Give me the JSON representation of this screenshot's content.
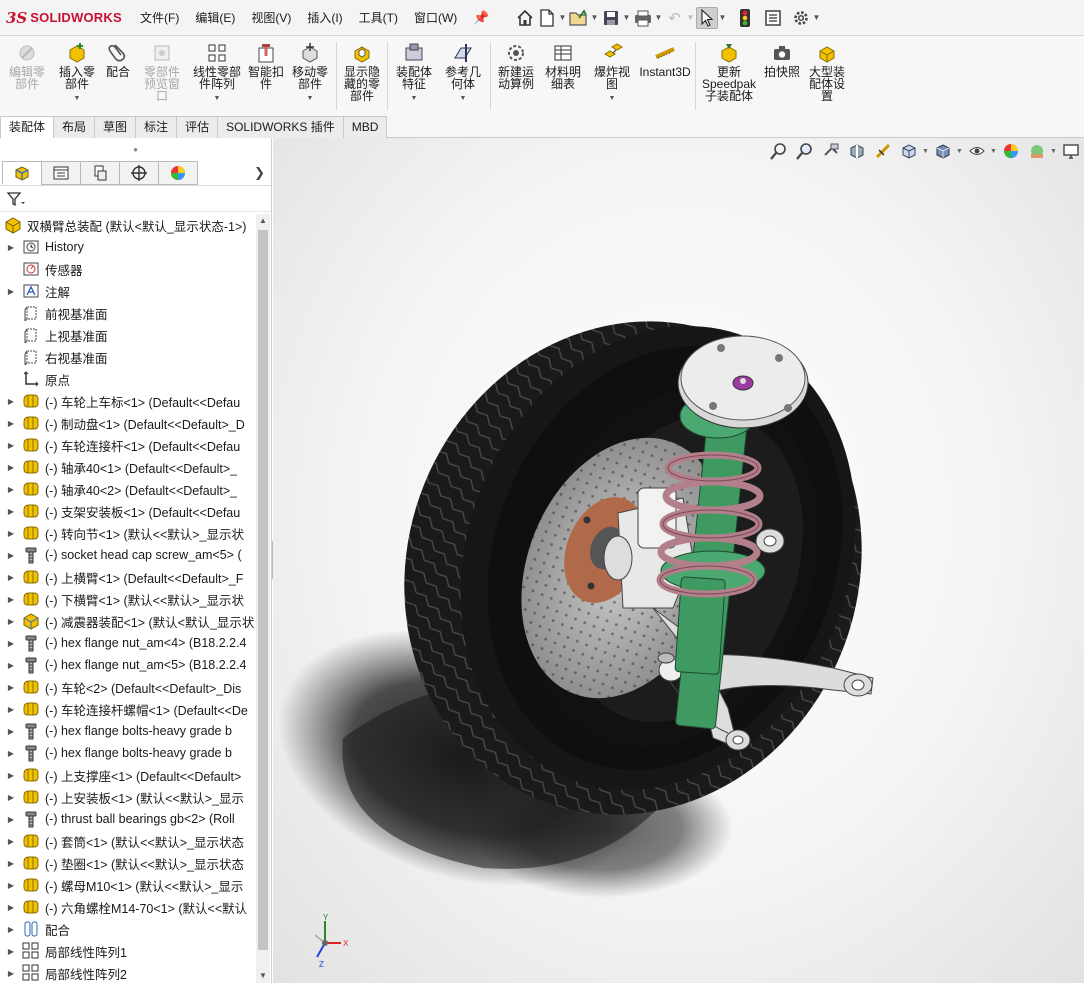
{
  "app": {
    "brand_ds": "3S",
    "brand_name": "SOLIDWORKS"
  },
  "menu": [
    "文件(F)",
    "编辑(E)",
    "视图(V)",
    "插入(I)",
    "工具(T)",
    "窗口(W)"
  ],
  "commands": [
    {
      "label": "编辑零\n部件",
      "disabled": true,
      "icon": "edit-component-icon"
    },
    {
      "label": "插入零\n部件",
      "disabled": false,
      "icon": "insert-component-icon",
      "dropdown": true
    },
    {
      "label": "配合",
      "disabled": false,
      "icon": "mate-icon"
    },
    {
      "label": "零部件\n预览窗\n口",
      "disabled": true,
      "icon": "component-preview-icon"
    },
    {
      "label": "线性零部\n件阵列",
      "disabled": false,
      "icon": "linear-pattern-icon",
      "dropdown": true
    },
    {
      "label": "智能扣\n件",
      "disabled": false,
      "icon": "smart-fastener-icon"
    },
    {
      "label": "移动零\n部件",
      "disabled": false,
      "icon": "move-component-icon",
      "dropdown": true
    },
    {
      "label": "显示隐\n藏的零\n部件",
      "disabled": false,
      "icon": "show-hidden-icon"
    },
    {
      "label": "装配体\n特征",
      "disabled": false,
      "icon": "assembly-feature-icon",
      "dropdown": true
    },
    {
      "label": "参考几\n何体",
      "disabled": false,
      "icon": "reference-geometry-icon",
      "dropdown": true
    },
    {
      "label": "新建运\n动算例",
      "disabled": false,
      "icon": "motion-study-icon"
    },
    {
      "label": "材料明\n细表",
      "disabled": false,
      "icon": "bom-icon"
    },
    {
      "label": "爆炸视\n图",
      "disabled": false,
      "icon": "exploded-view-icon",
      "dropdown": true
    },
    {
      "label": "Instant3D",
      "disabled": false,
      "icon": "instant3d-icon"
    },
    {
      "label": "更新\nSpeedpak\n子装配体",
      "disabled": false,
      "icon": "speedpak-icon"
    },
    {
      "label": "拍快照",
      "disabled": false,
      "icon": "snapshot-icon"
    },
    {
      "label": "大型装\n配体设\n置",
      "disabled": false,
      "icon": "large-assembly-icon"
    }
  ],
  "tabs": [
    {
      "label": "装配体",
      "active": true
    },
    {
      "label": "布局"
    },
    {
      "label": "草图"
    },
    {
      "label": "标注"
    },
    {
      "label": "评估"
    },
    {
      "label": "SOLIDWORKS 插件"
    },
    {
      "label": "MBD"
    }
  ],
  "tree": {
    "root": "双横臂总装配  (默认<默认_显示状态-1>)",
    "items": [
      {
        "label": "History",
        "icon": "history-icon",
        "expand": true
      },
      {
        "label": "传感器",
        "icon": "sensor-icon",
        "expand": false
      },
      {
        "label": "注解",
        "icon": "annotation-icon",
        "expand": true
      },
      {
        "label": "前视基准面",
        "icon": "plane-icon",
        "expand": false
      },
      {
        "label": "上视基准面",
        "icon": "plane-icon",
        "expand": false
      },
      {
        "label": "右视基准面",
        "icon": "plane-icon",
        "expand": false
      },
      {
        "label": "原点",
        "icon": "origin-icon",
        "expand": false
      },
      {
        "label": "(-) 车轮上车标<1> (Default<<Defau",
        "icon": "part-icon",
        "expand": true
      },
      {
        "label": "(-) 制动盘<1> (Default<<Default>_D",
        "icon": "part-icon",
        "expand": true
      },
      {
        "label": "(-) 车轮连接杆<1> (Default<<Defau",
        "icon": "part-icon",
        "expand": true
      },
      {
        "label": "(-) 轴承40<1> (Default<<Default>_",
        "icon": "part-icon",
        "expand": true
      },
      {
        "label": "(-) 轴承40<2> (Default<<Default>_",
        "icon": "part-icon",
        "expand": true
      },
      {
        "label": "(-) 支架安装板<1> (Default<<Defau",
        "icon": "part-icon",
        "expand": true
      },
      {
        "label": "(-) 转向节<1> (默认<<默认>_显示状",
        "icon": "part-icon",
        "expand": true
      },
      {
        "label": "(-) socket head cap screw_am<5> (",
        "icon": "toolbox-icon",
        "expand": true
      },
      {
        "label": "(-) 上横臂<1> (Default<<Default>_F",
        "icon": "part-icon",
        "expand": true
      },
      {
        "label": "(-) 下横臂<1> (默认<<默认>_显示状",
        "icon": "part-icon",
        "expand": true
      },
      {
        "label": "(-) 减震器装配<1> (默认<默认_显示状",
        "icon": "subassembly-icon",
        "expand": true
      },
      {
        "label": "(-) hex flange nut_am<4> (B18.2.2.4",
        "icon": "toolbox-icon",
        "expand": true
      },
      {
        "label": "(-) hex flange nut_am<5> (B18.2.2.4",
        "icon": "toolbox-icon",
        "expand": true
      },
      {
        "label": "(-) 车轮<2> (Default<<Default>_Dis",
        "icon": "part-icon",
        "expand": true
      },
      {
        "label": "(-) 车轮连接杆螺帽<1> (Default<<De",
        "icon": "part-icon",
        "expand": true
      },
      {
        "label": "(-) hex flange bolts-heavy grade b",
        "icon": "toolbox-icon",
        "expand": true
      },
      {
        "label": "(-) hex flange bolts-heavy grade b",
        "icon": "toolbox-icon",
        "expand": true
      },
      {
        "label": "(-) 上支撑座<1> (Default<<Default>",
        "icon": "part-icon",
        "expand": true
      },
      {
        "label": "(-) 上安装板<1> (默认<<默认>_显示",
        "icon": "part-icon",
        "expand": true
      },
      {
        "label": "(-) thrust ball bearings gb<2> (Roll",
        "icon": "toolbox-icon",
        "expand": true
      },
      {
        "label": "(-) 套筒<1> (默认<<默认>_显示状态",
        "icon": "part-icon",
        "expand": true
      },
      {
        "label": "(-) 垫圈<1> (默认<<默认>_显示状态",
        "icon": "part-icon",
        "expand": true
      },
      {
        "label": "(-) 螺母M10<1> (默认<<默认>_显示",
        "icon": "part-icon",
        "expand": true
      },
      {
        "label": "(-) 六角螺栓M14-70<1> (默认<<默认",
        "icon": "part-icon",
        "expand": true
      },
      {
        "label": "配合",
        "icon": "mates-folder-icon",
        "expand": true
      },
      {
        "label": "局部线性阵列1",
        "icon": "pattern-icon",
        "expand": true
      },
      {
        "label": "局部线性阵列2",
        "icon": "pattern-icon",
        "expand": true
      }
    ]
  },
  "triad": {
    "x": "X",
    "y": "Y",
    "z": "Z"
  },
  "colors": {
    "accent": "#c8102e",
    "part_yellow": "#f2c200",
    "strut_green": "#3f9a62",
    "spring_pink": "#b27f8a"
  }
}
